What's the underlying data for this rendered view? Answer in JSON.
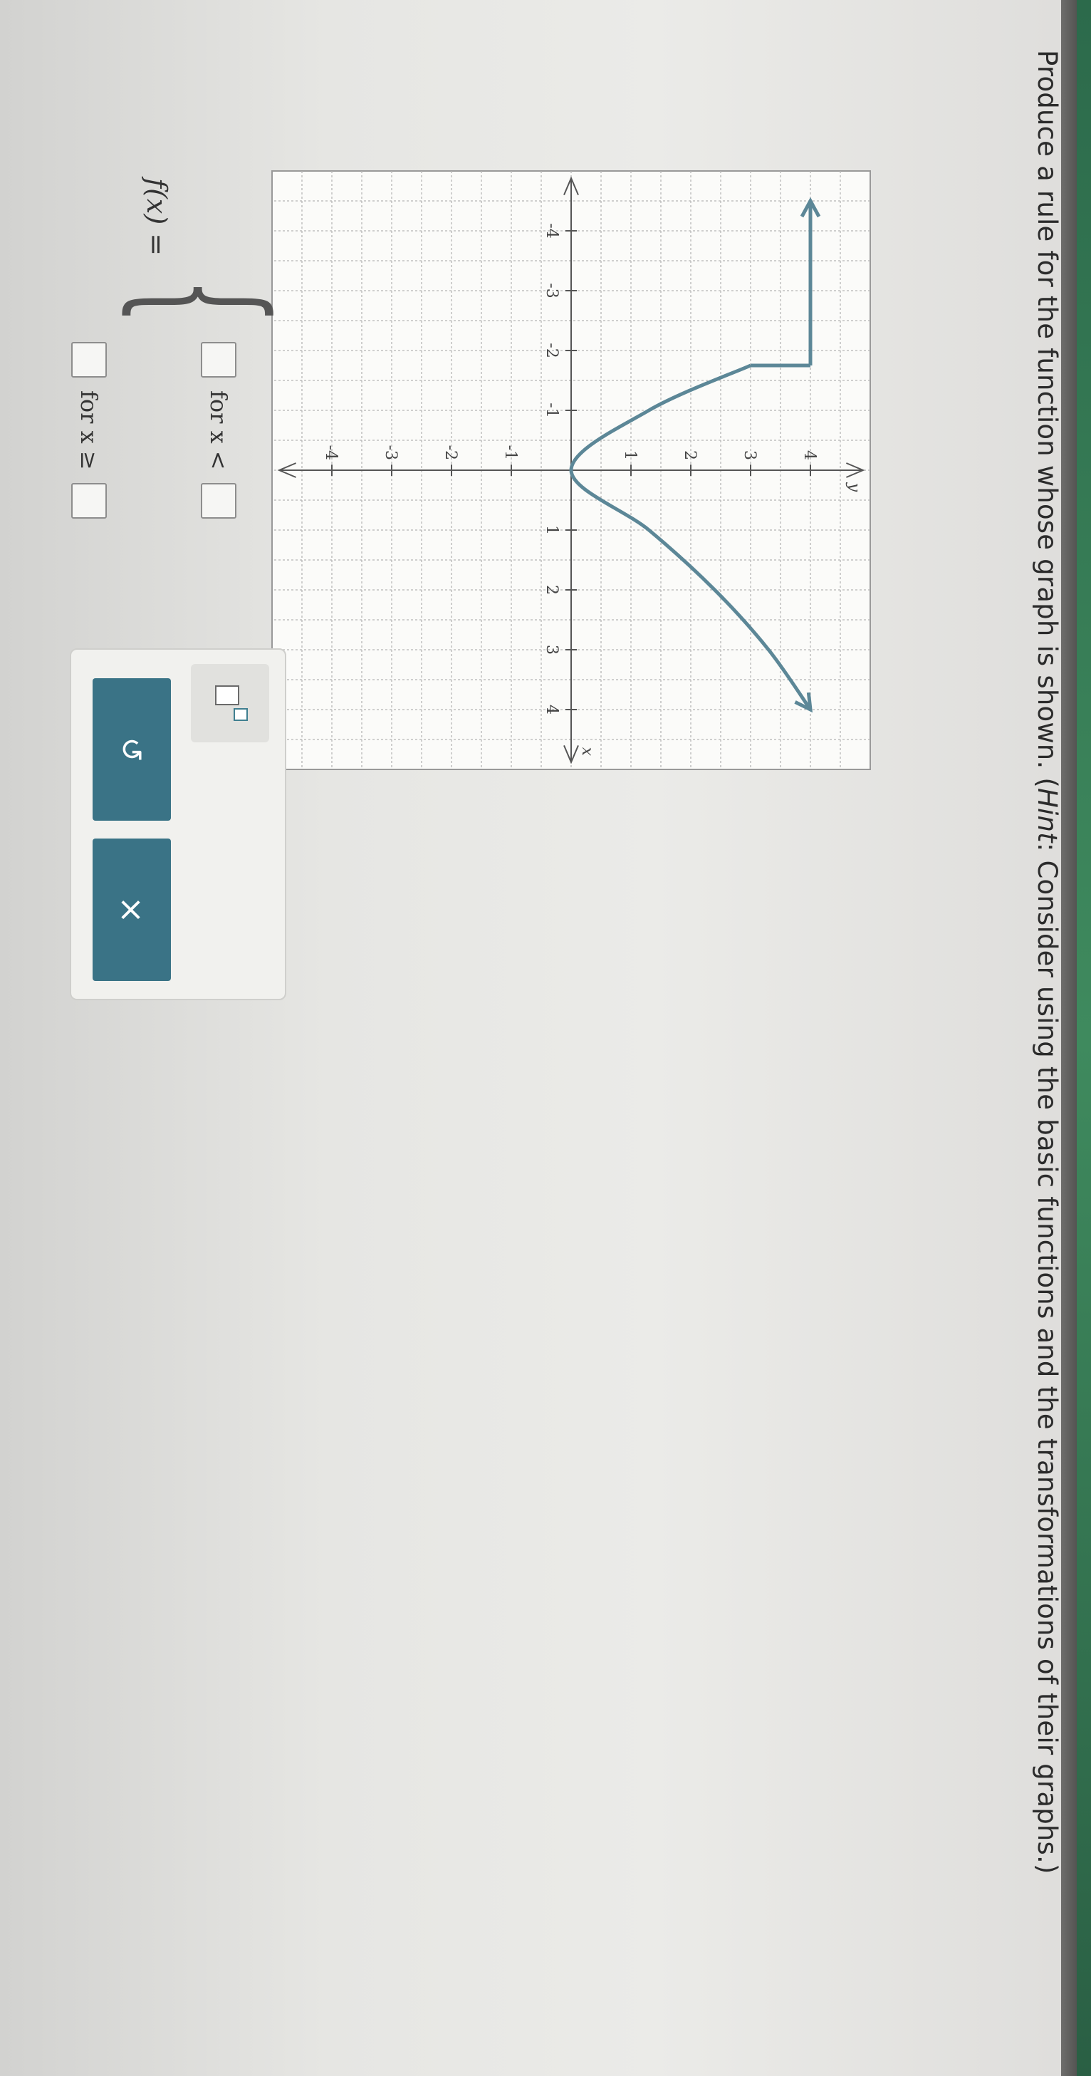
{
  "prompt": {
    "before_hint": "Produce a rule for the function whose graph is shown. (",
    "hint_label": "Hint",
    "after_hint": ": Consider using the basic functions and the transformations of their graphs.)"
  },
  "answer": {
    "fx_label": "f(x) =",
    "piece1_text": "for x <",
    "piece2_text": "for x ≥"
  },
  "toolbar": {
    "undo_symbol": "↺",
    "clear_symbol": "×"
  },
  "colors": {
    "curve": "#5c8797",
    "button": "#3a7386"
  },
  "chart_data": {
    "type": "line",
    "xlabel": "x",
    "ylabel": "y",
    "xlim": [
      -4.5,
      5
    ],
    "ylim": [
      -4.5,
      5
    ],
    "x_ticks": [
      -4,
      -3,
      -2,
      -1,
      1,
      2,
      3,
      4
    ],
    "y_ticks": [
      -4,
      -3,
      -2,
      -1,
      1,
      2,
      3,
      4
    ],
    "grid": true,
    "series": [
      {
        "segments": [
          {
            "type": "horizontal",
            "x": [
              -4.5,
              -1.75
            ],
            "y": 4,
            "arrow_left": true
          },
          {
            "type": "vertical",
            "x": -1.75,
            "y": [
              3,
              4
            ]
          },
          {
            "type": "curve",
            "x": [
              -1.75,
              -1,
              0,
              1,
              2,
              3,
              4
            ],
            "y": [
              3,
              1.3,
              0,
              1.3,
              2.4,
              3.3,
              4
            ],
            "arrow_right": true
          }
        ]
      }
    ]
  }
}
